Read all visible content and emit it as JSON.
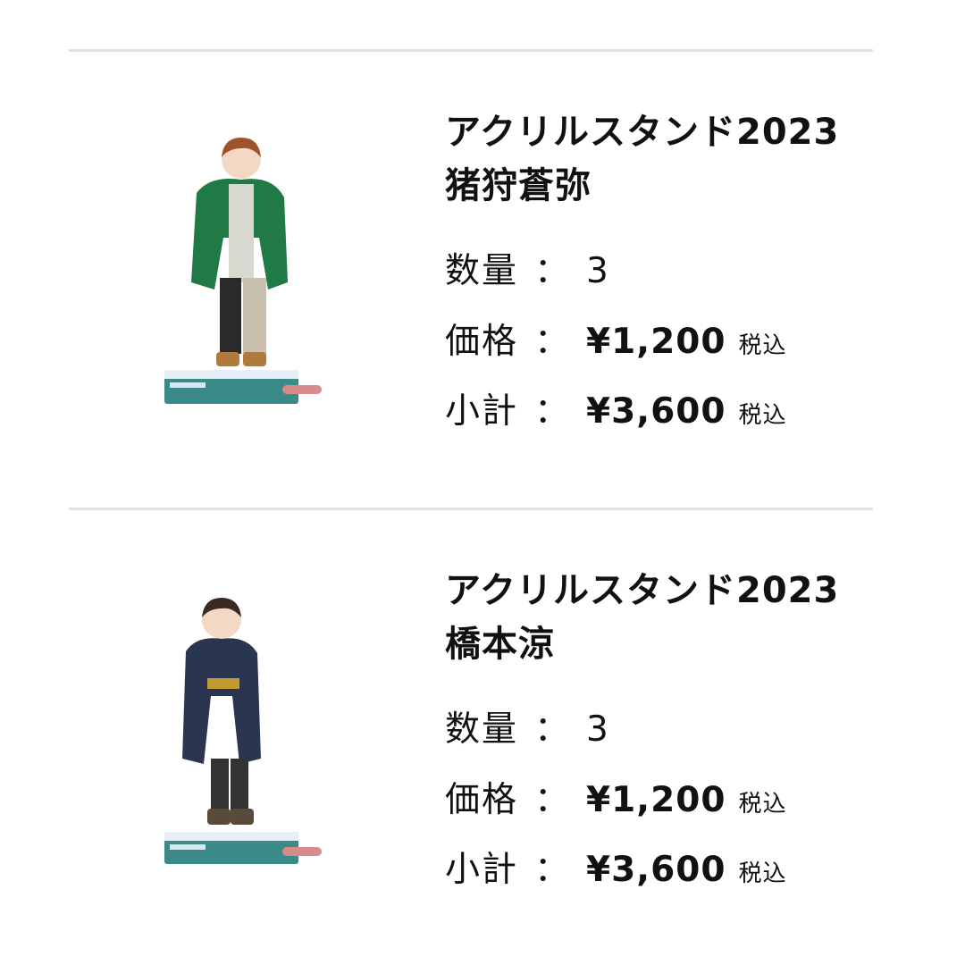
{
  "items": [
    {
      "title_line1": "アクリルスタンド2023",
      "title_line2": "猪狩蒼弥",
      "quantity_label": "数量",
      "quantity": "3",
      "price_label": "価格",
      "price": "¥1,200",
      "subtotal_label": "小計",
      "subtotal": "¥3,600",
      "tax_note": "税込",
      "colon": "：",
      "jacket_color": "#1f7a45"
    },
    {
      "title_line1": "アクリルスタンド2023",
      "title_line2": "橋本涼",
      "quantity_label": "数量",
      "quantity": "3",
      "price_label": "価格",
      "price": "¥1,200",
      "subtotal_label": "小計",
      "subtotal": "¥3,600",
      "tax_note": "税込",
      "colon": "：",
      "jacket_color": "#2a3550"
    }
  ]
}
